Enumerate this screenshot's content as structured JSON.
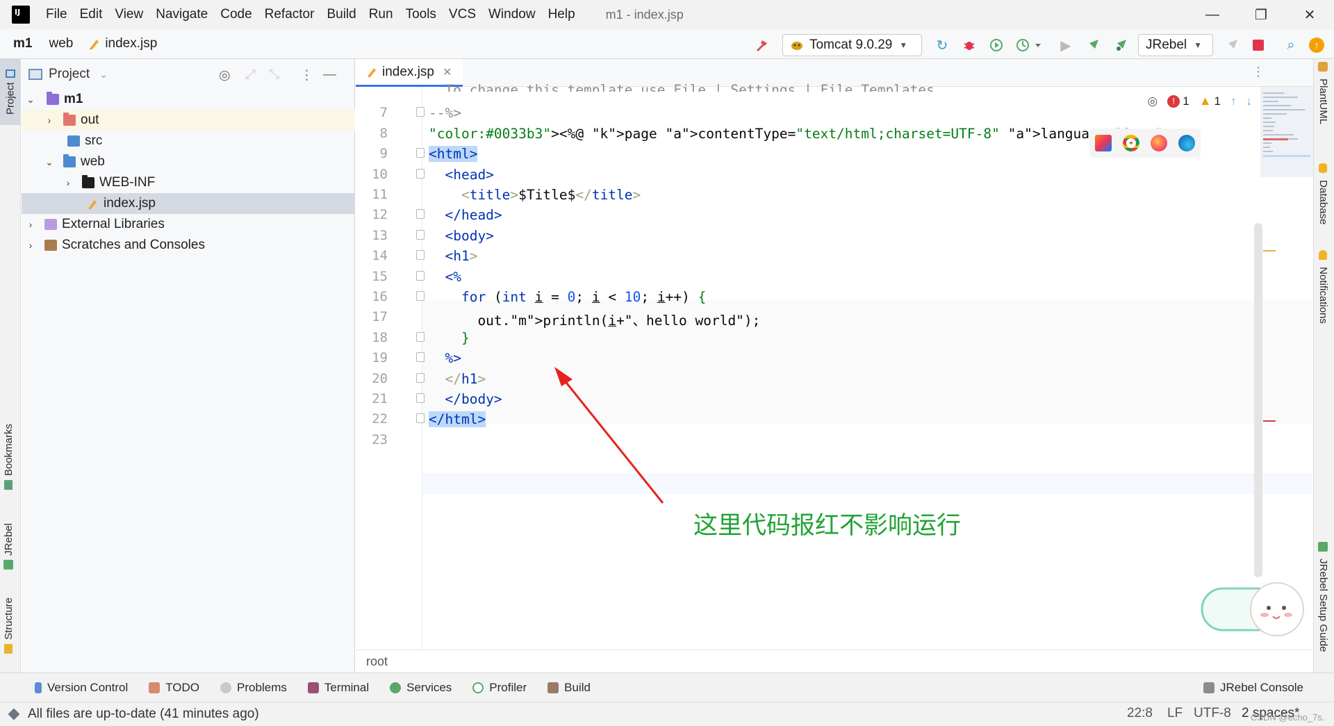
{
  "menubar": {
    "logo_text": "IJ",
    "items": [
      {
        "label": "File"
      },
      {
        "label": "Edit"
      },
      {
        "label": "View"
      },
      {
        "label": "Navigate"
      },
      {
        "label": "Code"
      },
      {
        "label": "Refactor"
      },
      {
        "label": "Build"
      },
      {
        "label": "Run"
      },
      {
        "label": "Tools"
      },
      {
        "label": "VCS"
      },
      {
        "label": "Window"
      },
      {
        "label": "Help"
      }
    ],
    "window_title": "m1 - index.jsp",
    "minimize": "—",
    "restore": "❐",
    "close": "✕"
  },
  "navbar": {
    "project": "m1",
    "folder": "web",
    "file": "index.jsp",
    "run_config": "Tomcat 9.0.29",
    "jrebel": "JRebel"
  },
  "left_stripe": {
    "project": "Project",
    "bookmarks": "Bookmarks",
    "jrebel": "JRebel",
    "structure": "Structure"
  },
  "project_panel": {
    "title": "Project",
    "tree": [
      {
        "label": "m1"
      },
      {
        "label": "out"
      },
      {
        "label": "src"
      },
      {
        "label": "web"
      },
      {
        "label": "WEB-INF"
      },
      {
        "label": "index.jsp"
      },
      {
        "label": "External Libraries"
      },
      {
        "label": "Scratches and Consoles"
      }
    ]
  },
  "editor": {
    "tab_label": "index.jsp",
    "top_partial_line": "  To change this template use File | Settings | File Templates.",
    "line_numbers": [
      "7",
      "8",
      "9",
      "10",
      "11",
      "12",
      "13",
      "14",
      "15",
      "16",
      "17",
      "18",
      "19",
      "20",
      "21",
      "22",
      "23"
    ],
    "lines": [
      "--%>",
      "<%@ page contentType=\"text/html;charset=UTF-8\" language=\"java\" %>",
      "<html>",
      "  <head>",
      "    <title>$Title$</title>",
      "  </head>",
      "  <body>",
      "  <h1>",
      "  <%",
      "    for (int i = 0; i < 10; i++) {",
      "      out.println(i+\"、hello world\");",
      "    }",
      "  %>",
      "  </h1>",
      "  </body>",
      "</html>",
      ""
    ],
    "errors": "1",
    "warnings": "1",
    "breadcrumb": "root"
  },
  "annotation": {
    "text": "这里代码报红不影响运行",
    "color": "#21a335",
    "arrow_color": "#e8231d"
  },
  "right_stripe": {
    "plantuml": "PlantUML",
    "database": "Database",
    "notifications": "Notifications",
    "jrebel_setup": "JRebel Setup Guide"
  },
  "tool_tabs": [
    {
      "label": "Version Control"
    },
    {
      "label": "TODO"
    },
    {
      "label": "Problems"
    },
    {
      "label": "Terminal"
    },
    {
      "label": "Services"
    },
    {
      "label": "Profiler"
    },
    {
      "label": "Build"
    }
  ],
  "jrebel_console": "JRebel Console",
  "status": {
    "message": "All files are up-to-date (41 minutes ago)",
    "position": "22:8",
    "line_sep": "LF",
    "encoding": "UTF-8",
    "indent": "2 spaces*",
    "watermark": "CSDN @echo_7s."
  }
}
